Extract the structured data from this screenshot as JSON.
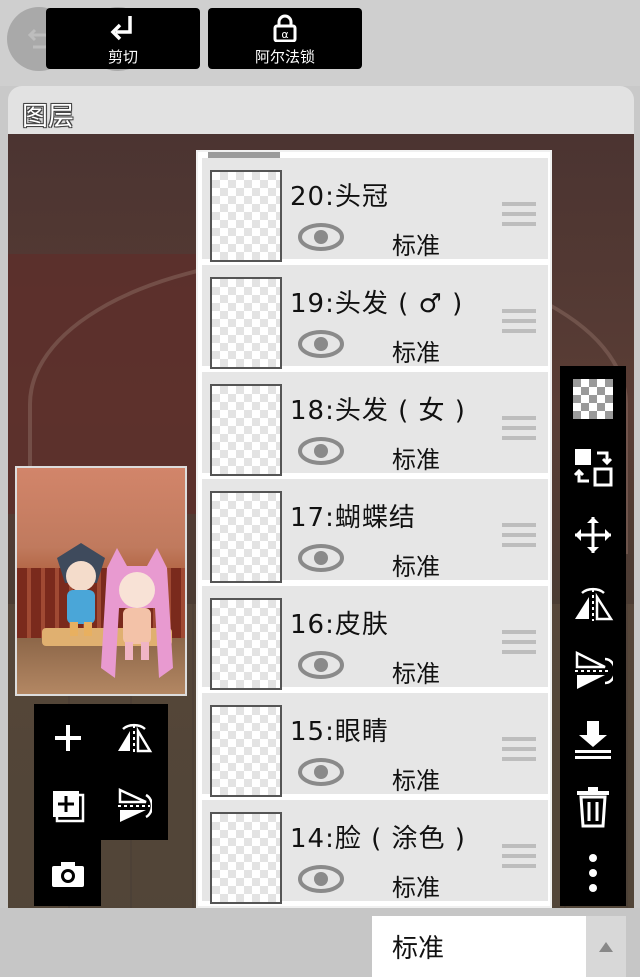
{
  "header": {
    "undo_icon": "undo-icon",
    "redo_icon": "redo-icon",
    "panel_title": "图层"
  },
  "layers": [
    {
      "name": "20:头冠",
      "blend": "标准",
      "visible": true
    },
    {
      "name": "19:头发 ( ♂ )",
      "blend": "标准",
      "visible": true
    },
    {
      "name": "18:头发 ( 女 )",
      "blend": "标准",
      "visible": true
    },
    {
      "name": "17:蝴蝶结",
      "blend": "标准",
      "visible": true
    },
    {
      "name": "16:皮肤",
      "blend": "标准",
      "visible": true
    },
    {
      "name": "15:眼睛",
      "blend": "标准",
      "visible": true
    },
    {
      "name": "14:脸 ( 涂色 )",
      "blend": "标准",
      "visible": true
    }
  ],
  "left_tools": [
    "add-layer-icon",
    "flip-horizontal-icon",
    "add-image-layer-icon",
    "flip-vertical-icon",
    "camera-icon"
  ],
  "right_tools": [
    "transparency-icon",
    "swap-layers-icon",
    "move-icon",
    "flip-horizontal-icon",
    "flip-vertical-icon",
    "merge-down-icon",
    "trash-icon",
    "more-icon"
  ],
  "bottom": {
    "clip_label": "剪切",
    "alpha_lock_label": "阿尔法锁",
    "blend_mode": "标准"
  }
}
